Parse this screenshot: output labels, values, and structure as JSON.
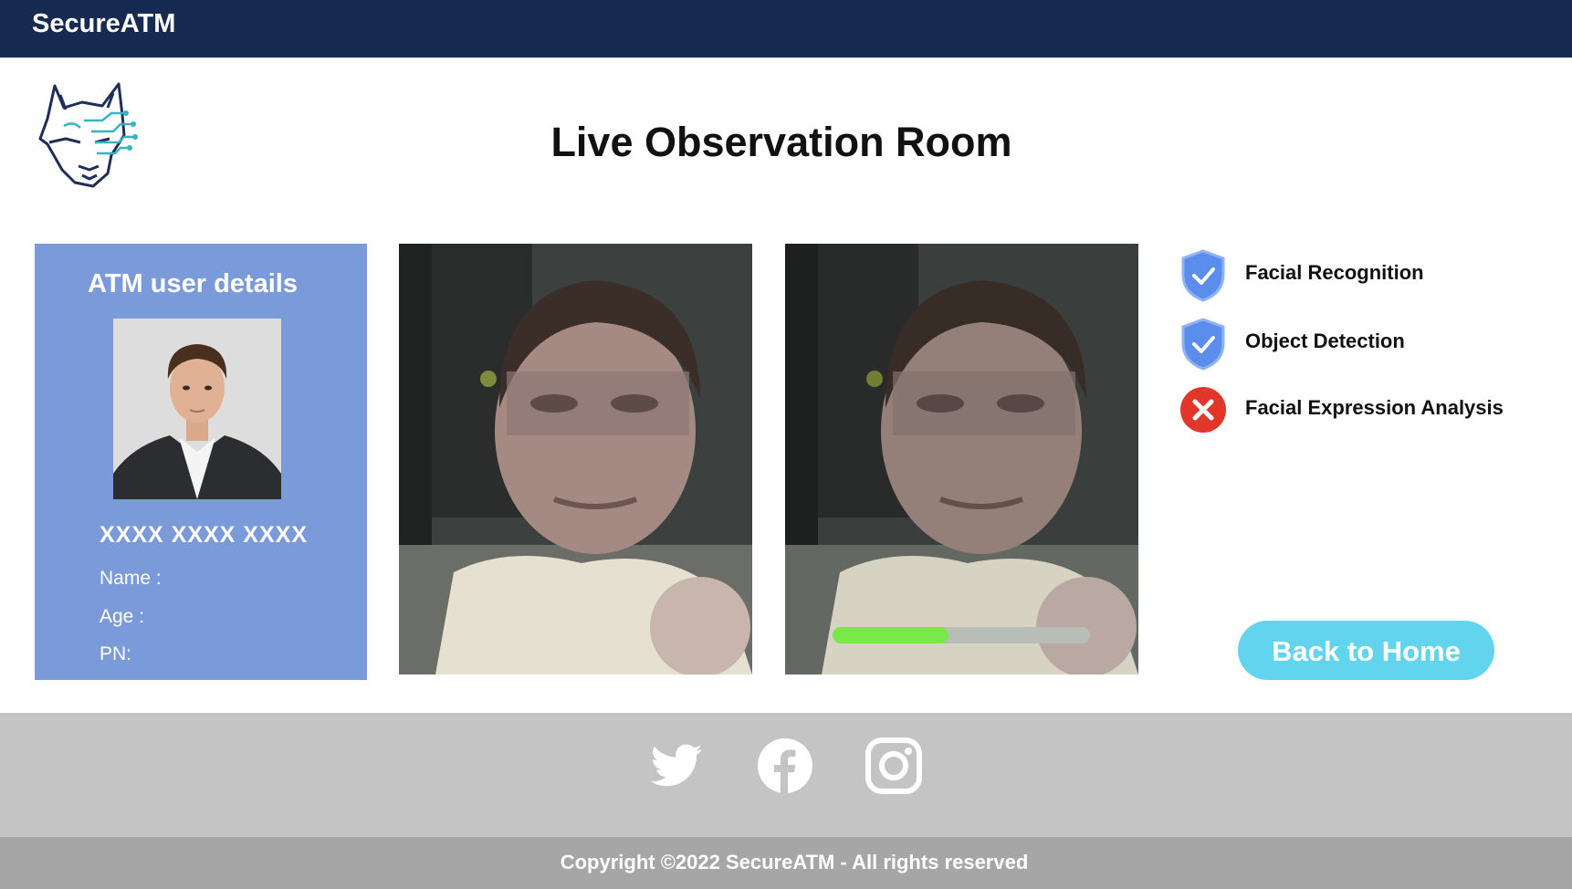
{
  "app": {
    "brand": "SecureATM"
  },
  "page": {
    "title": "Live Observation Room"
  },
  "user_details": {
    "title": "ATM user details",
    "card_number": "XXXX XXXX XXXX",
    "name_label": "Name :",
    "age_label": "Age :",
    "pn_label": "PN:"
  },
  "camera": {
    "progress": 0.45
  },
  "checks": [
    {
      "label": "Facial Recognition",
      "status": "passed",
      "icon": "shield-check-icon"
    },
    {
      "label": "Object Detection",
      "status": "passed",
      "icon": "shield-check-icon"
    },
    {
      "label": "Facial Expression Analysis",
      "status": "failed",
      "icon": "x-circle-icon"
    }
  ],
  "back_button": {
    "label": "Back to Home"
  },
  "social": [
    "twitter-icon",
    "facebook-icon",
    "instagram-icon"
  ],
  "footer": {
    "copyright": "Copyright ©2022 SecureATM - All rights reserved"
  },
  "colors": {
    "header": "#172a52",
    "details_panel": "#7b9ad9",
    "accent_button": "#63d4ee",
    "progress": "#7be84a",
    "shield": "#5b8ded",
    "error": "#e2362b"
  }
}
